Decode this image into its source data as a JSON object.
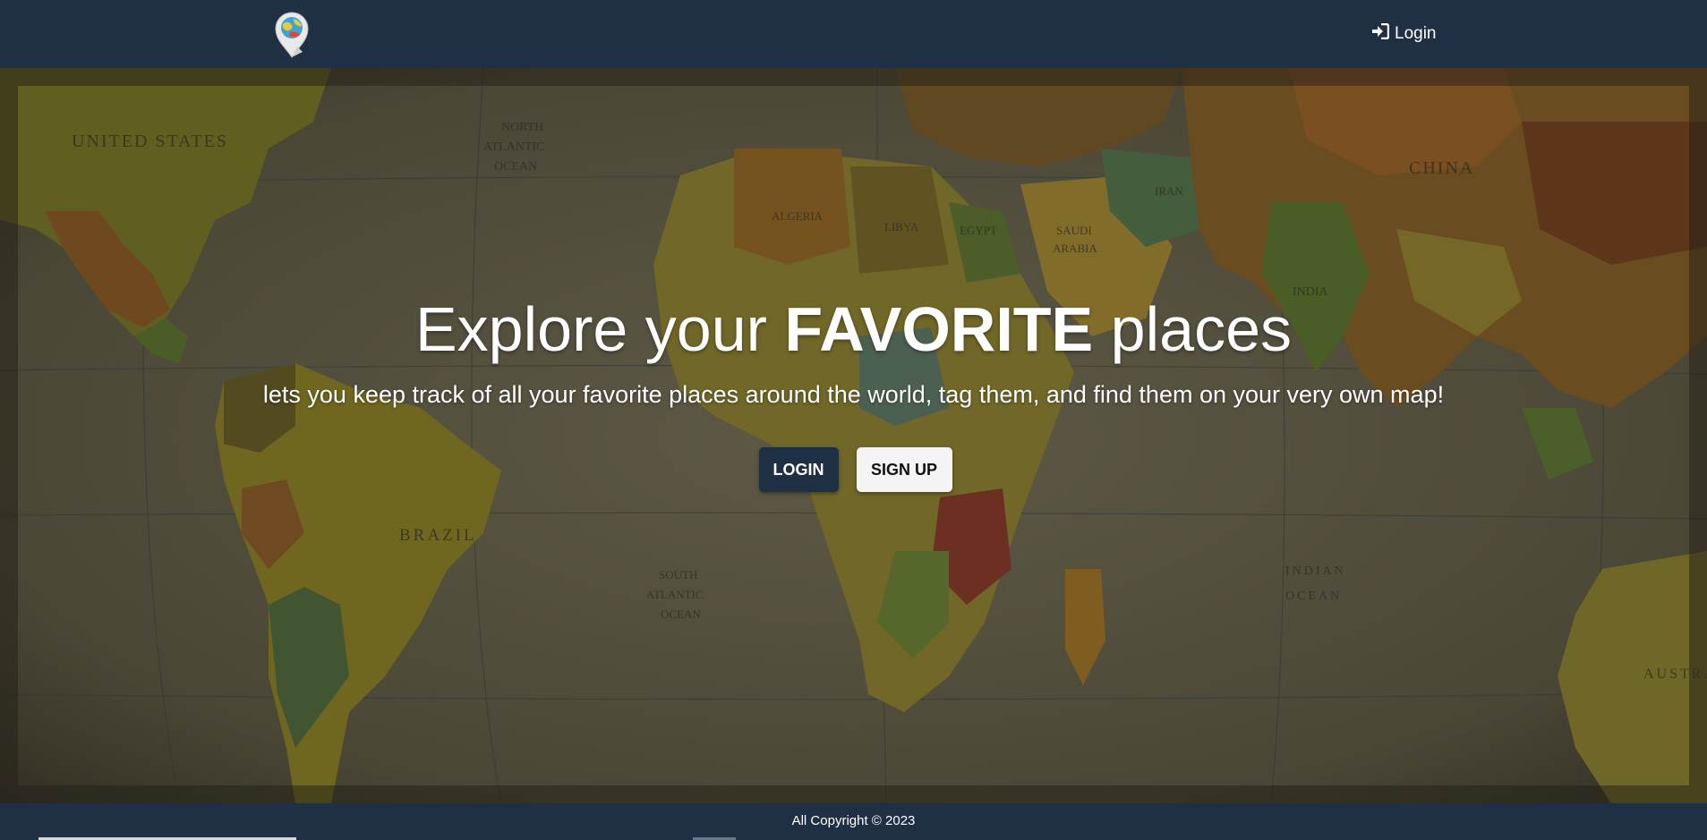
{
  "app": {
    "logo_name": "map-pin-globe-logo"
  },
  "nav": {
    "login_icon": "sign-in-icon",
    "login_label": "Login"
  },
  "hero": {
    "headline_pre": "Explore your ",
    "headline_bold": "FAVORITE",
    "headline_post": " places",
    "subline": "lets you keep track of all your favorite places around the world, tag them, and find them on your very own map!",
    "login_button": "LOGIN",
    "signup_button": "SIGN UP",
    "map_labels": {
      "united_states": "UNITED STATES",
      "north_atlantic_1": "NORTH",
      "north_atlantic_2": "ATLANTIC",
      "north_atlantic_3": "OCEAN",
      "brazil": "BRAZIL",
      "south_atlantic_1": "SOUTH",
      "south_atlantic_2": "ATLANTIC",
      "south_atlantic_3": "OCEAN",
      "algeria": "ALGERIA",
      "libya": "LIBYA",
      "egypt": "EGYPT",
      "saudi_arabia_1": "SAUDI",
      "saudi_arabia_2": "ARABIA",
      "iran": "IRAN",
      "india": "INDIA",
      "china": "CHINA",
      "indian_ocean_1": "INDIAN",
      "indian_ocean_2": "OCEAN",
      "australia": "AUSTRA"
    }
  },
  "footer": {
    "copyright": "All Copyright © 2023"
  },
  "colors": {
    "navy": "#1f2f44",
    "white": "#ffffff",
    "light_button": "#f4f4f4"
  }
}
